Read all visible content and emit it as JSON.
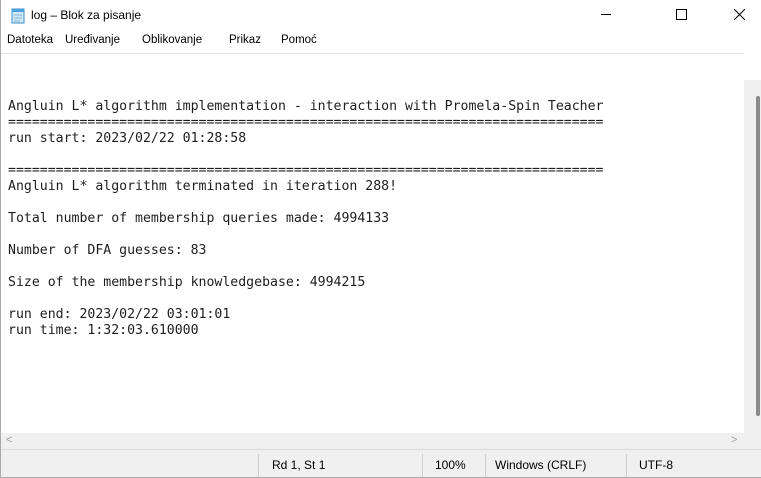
{
  "window": {
    "title": "log – Blok za pisanje",
    "icon": "notepad-icon",
    "controls": {
      "minimize": "minimize-icon",
      "maximize": "maximize-icon",
      "close": "close-icon"
    }
  },
  "menu": {
    "items": [
      "Datoteka",
      "Uređivanje",
      "Oblikovanje",
      "Prikaz",
      "Pomoć"
    ]
  },
  "document": {
    "lines": [
      "Angluin L* algorithm implementation - interaction with Promela-Spin Teacher",
      "===========================================================================",
      "run start: 2023/02/22 01:28:58",
      "",
      "===========================================================================",
      "Angluin L* algorithm terminated in iteration 288!",
      "",
      "Total number of membership queries made: 4994133",
      "",
      "Number of DFA guesses: 83",
      "",
      "Size of the membership knowledgebase: 4994215",
      "",
      "run end: 2023/02/22 03:01:01",
      "run time: 1:32:03.610000"
    ]
  },
  "statusbar": {
    "position": "Rd 1, St 1",
    "zoom": "100%",
    "line_endings": "Windows (CRLF)",
    "encoding": "UTF-8"
  }
}
